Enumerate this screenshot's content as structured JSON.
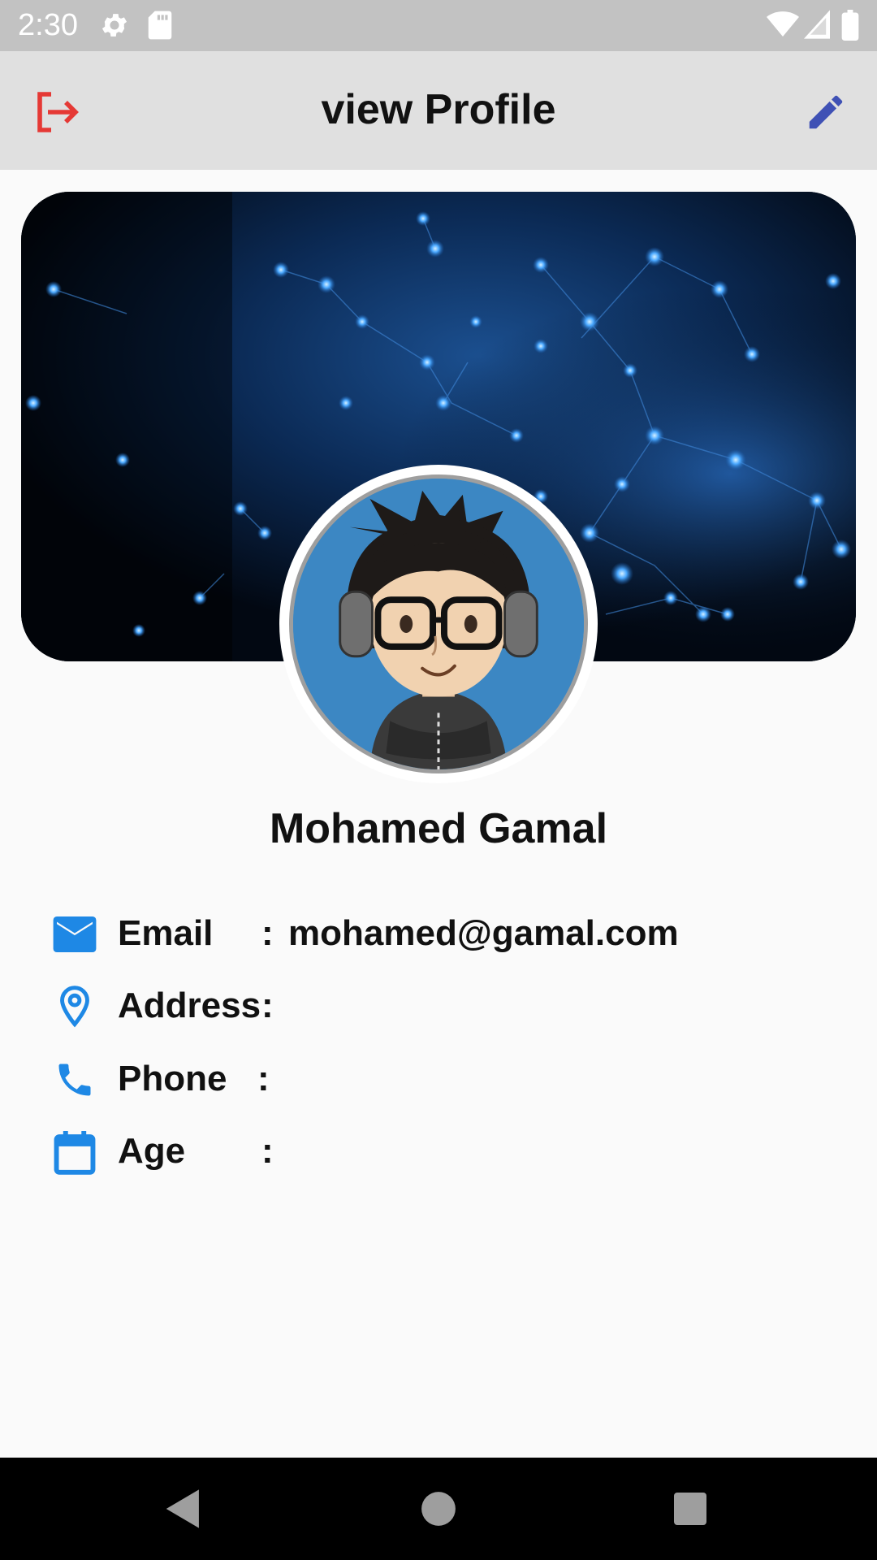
{
  "status_bar": {
    "time": "2:30",
    "icons": [
      "gear-icon",
      "sd-card-icon",
      "wifi-icon",
      "signal-icon",
      "battery-icon"
    ]
  },
  "app_bar": {
    "title": "view Profile",
    "logout_icon": "logout-icon",
    "edit_icon": "edit-icon",
    "logout_color": "#e53935",
    "edit_color": "#3f51b5"
  },
  "profile": {
    "name": "Mohamed Gamal"
  },
  "info": {
    "email": {
      "icon": "email-icon",
      "label": "Email",
      "colon": ":",
      "value": "mohamed@gamal.com"
    },
    "address": {
      "icon": "location-pin-icon",
      "label": "Address",
      "colon": ":",
      "value": ""
    },
    "phone": {
      "icon": "phone-icon",
      "label": "Phone",
      "colon": ":",
      "value": ""
    },
    "age": {
      "icon": "calendar-icon",
      "label": "Age",
      "colon": ":",
      "value": ""
    }
  },
  "colors": {
    "accent_blue": "#1e88e5",
    "app_bar_bg": "#e0e0e0",
    "status_bar_bg": "#c2c2c2"
  },
  "nav_bar": {
    "icons": [
      "back-icon",
      "home-icon",
      "recents-icon"
    ]
  }
}
